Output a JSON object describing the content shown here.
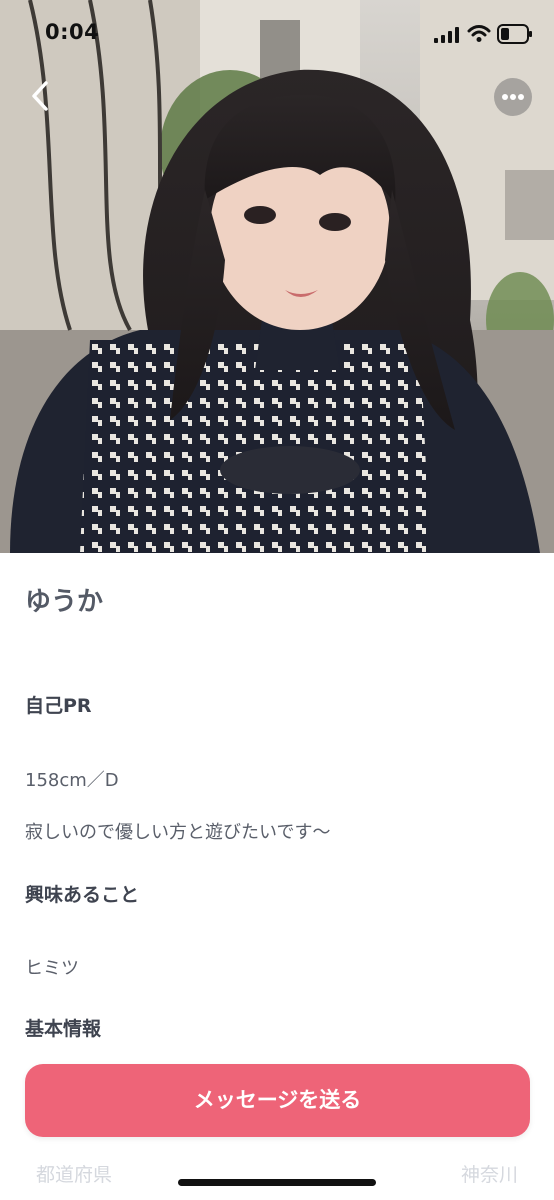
{
  "status_bar": {
    "time": "0:04"
  },
  "photo": {
    "subject": "profile-photo"
  },
  "profile": {
    "name": "ゆうか",
    "self_pr_title": "自己PR",
    "self_pr_stats": "158cm／D",
    "self_pr_text": "寂しいので優しい方と遊びたいです〜",
    "interests_title": "興味あること",
    "interests_text": "ヒミツ",
    "basic_info_title": "基本情報",
    "basic_info": {
      "label": "都道府県",
      "value": "神奈川"
    }
  },
  "actions": {
    "message_button": "メッセージを送る"
  },
  "colors": {
    "accent": "#ee6478",
    "text": "#4a4f5a"
  },
  "icons": {
    "back": "chevron-left-icon",
    "more": "more-dots-icon",
    "signal": "signal-icon",
    "wifi": "wifi-icon",
    "battery": "battery-icon"
  }
}
